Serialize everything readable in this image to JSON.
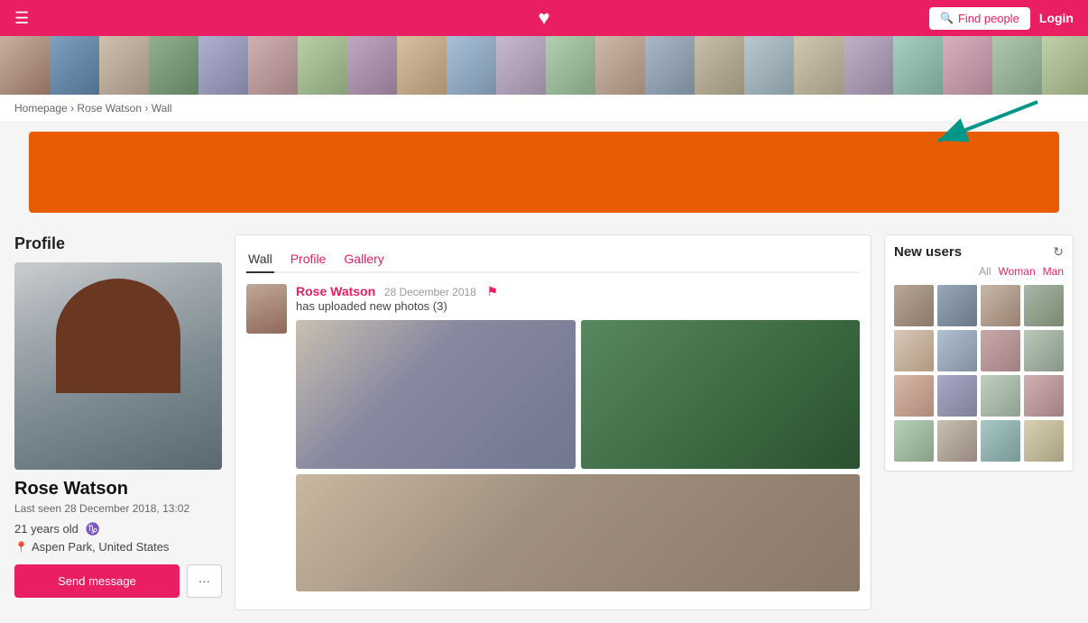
{
  "header": {
    "logo_icon": "♥",
    "find_people_label": "Find people",
    "login_label": "Login"
  },
  "breadcrumb": {
    "homepage": "Homepage",
    "sep1": "›",
    "profile_name": "Rose Watson",
    "sep2": "›",
    "current": "Wall"
  },
  "profile": {
    "section_title": "Profile",
    "name": "Rose Watson",
    "last_seen": "Last seen 28 December 2018, 13:02",
    "age": "21 years old",
    "zodiac_sign": "♑",
    "location": "Aspen Park, United States",
    "send_message": "Send message",
    "more_options": "···"
  },
  "wall": {
    "tabs": [
      {
        "label": "Wall",
        "active": true
      },
      {
        "label": "Profile",
        "active": false
      },
      {
        "label": "Gallery",
        "active": false
      }
    ],
    "post": {
      "author": "Rose Watson",
      "date": "28 December 2018",
      "description": "has uploaded new photos (3)"
    }
  },
  "new_users": {
    "title": "New users",
    "filters": [
      {
        "label": "All",
        "active": true
      },
      {
        "label": "Woman",
        "active": false
      },
      {
        "label": "Man",
        "active": false
      }
    ],
    "refresh_icon": "↻"
  },
  "strip_avatars": [
    "strip-c1",
    "strip-c2",
    "strip-c3",
    "strip-c4",
    "strip-c5",
    "strip-c6",
    "strip-c7",
    "strip-c8",
    "strip-c9",
    "strip-c10",
    "strip-c11",
    "strip-c12",
    "strip-c13",
    "strip-c14",
    "strip-c15",
    "strip-c16",
    "strip-c17",
    "strip-c18",
    "strip-c19",
    "strip-c20",
    "strip-c21",
    "strip-c22"
  ],
  "new_user_colors": [
    "c1",
    "c2",
    "c3",
    "c4",
    "c5",
    "c6",
    "c7",
    "c8",
    "c9",
    "c10",
    "c11",
    "c12",
    "c13",
    "c14",
    "c15",
    "c16"
  ]
}
